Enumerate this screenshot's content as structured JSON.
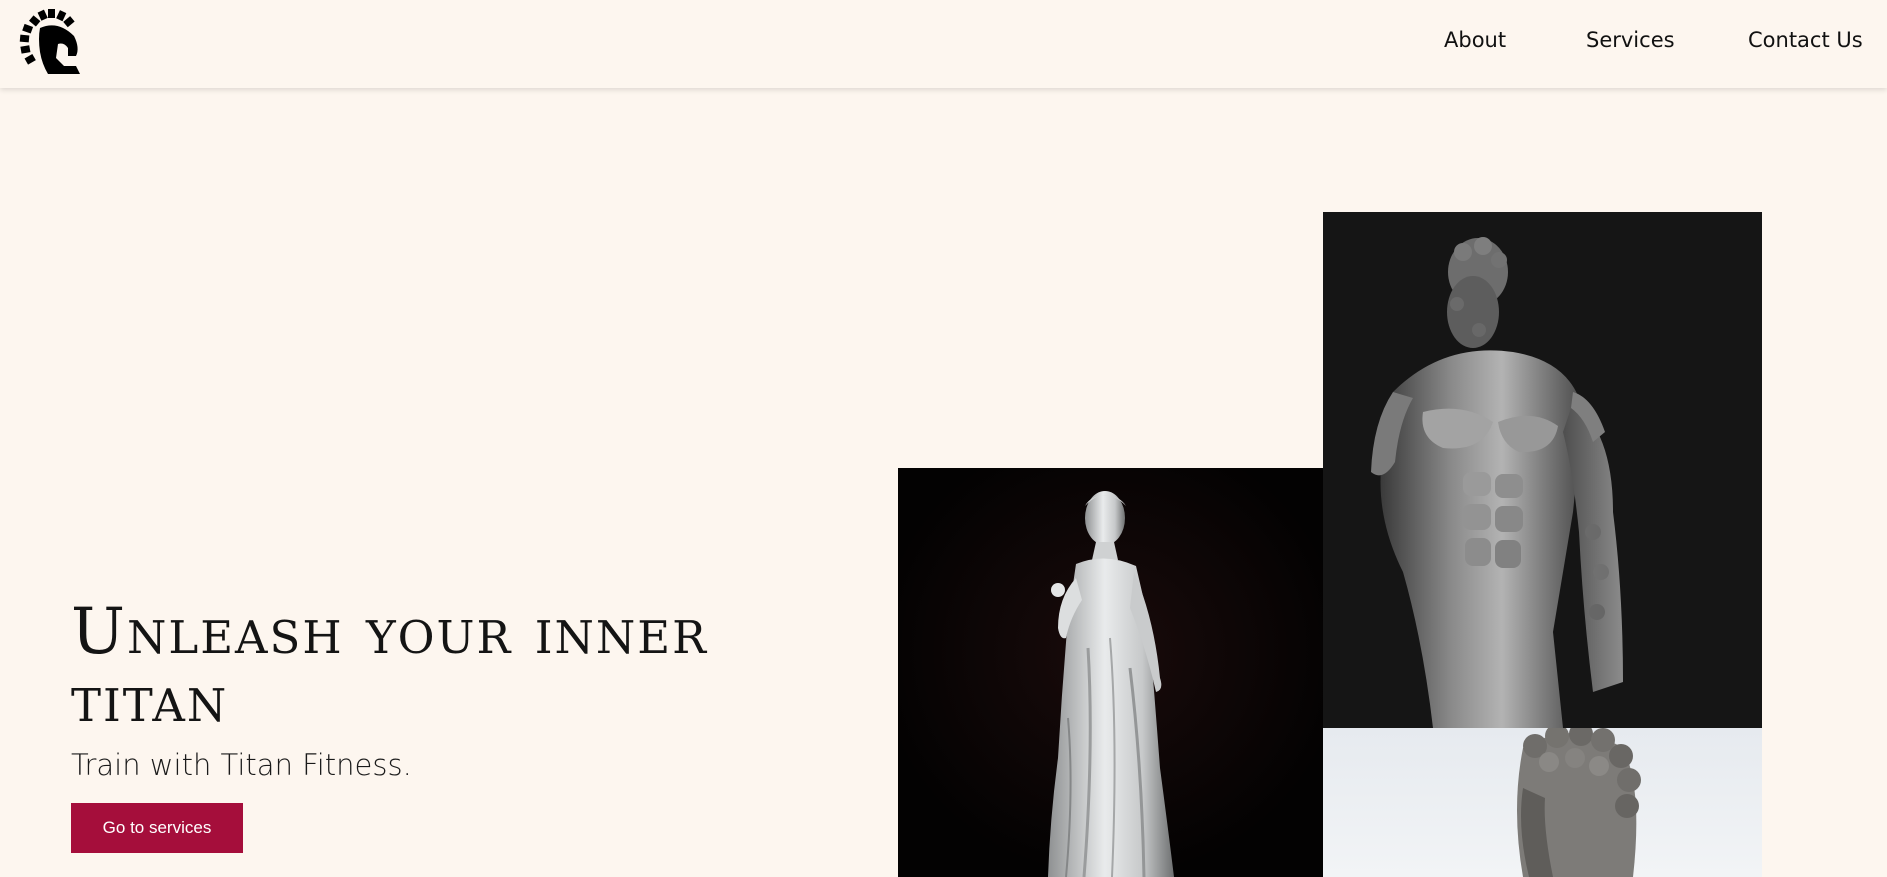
{
  "nav": {
    "logo_name": "spartan-helmet-icon",
    "links": [
      "About",
      "Services",
      "Contact Us"
    ]
  },
  "hero": {
    "title": "Unleash your inner titan",
    "subtitle": "Train with Titan Fitness.",
    "cta_label": "Go to services"
  },
  "colors": {
    "background": "#fdf6ef",
    "accent": "#a50e3b",
    "text": "#111111"
  },
  "images": [
    {
      "name": "marble-statue-draped-woman"
    },
    {
      "name": "marble-statue-hercules-torso"
    },
    {
      "name": "marble-statue-curly-head"
    }
  ]
}
